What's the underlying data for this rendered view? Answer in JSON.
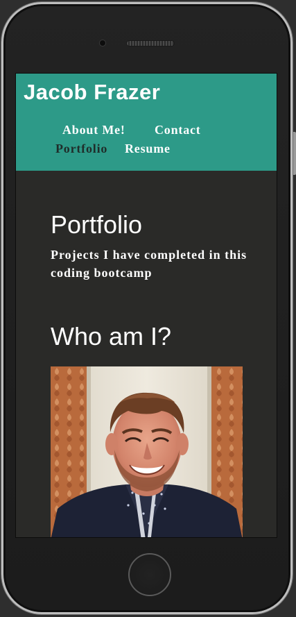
{
  "header": {
    "site_title": "Jacob Frazer",
    "nav": [
      {
        "label": "About Me!",
        "active": false
      },
      {
        "label": "Contact",
        "active": false
      },
      {
        "label": "Portfolio",
        "active": true
      },
      {
        "label": "Resume",
        "active": false
      }
    ]
  },
  "main": {
    "portfolio": {
      "heading": "Portfolio",
      "description": "Projects I have completed in this coding bootcamp"
    },
    "about": {
      "heading": "Who am I?"
    }
  },
  "colors": {
    "header_bg": "#2d9a88",
    "page_bg": "#2a2a28",
    "active_nav": "#1f2d2a",
    "text": "#ffffff"
  },
  "icons": [
    "camera-icon",
    "speaker-grille-icon",
    "home-button-icon"
  ]
}
